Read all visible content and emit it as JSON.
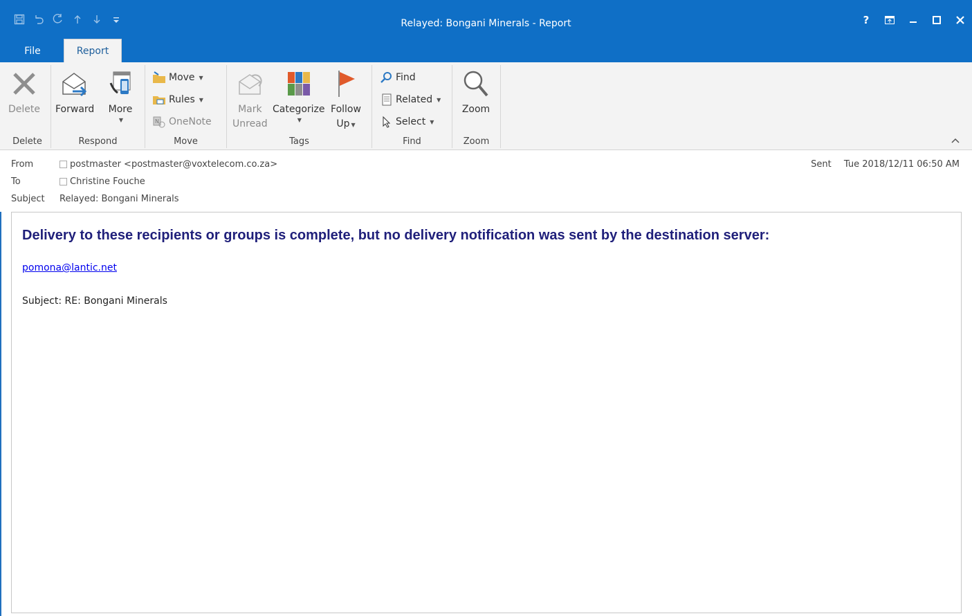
{
  "window": {
    "title": "Relayed: Bongani Minerals - Report",
    "help_label": "?",
    "accent": "#0f6fc6"
  },
  "quick_access": [
    "save-icon",
    "undo-icon",
    "redo-icon",
    "up-icon",
    "down-icon",
    "customize-icon"
  ],
  "tabs": {
    "file": "File",
    "report": "Report"
  },
  "ribbon": {
    "delete": {
      "button": "Delete",
      "group": "Delete"
    },
    "respond": {
      "forward": "Forward",
      "more": "More",
      "group": "Respond"
    },
    "move": {
      "move": "Move",
      "rules": "Rules",
      "onenote": "OneNote",
      "group": "Move"
    },
    "tags": {
      "mark_l1": "Mark",
      "mark_l2": "Unread",
      "categorize": "Categorize",
      "follow_l1": "Follow",
      "follow_l2": "Up",
      "group": "Tags"
    },
    "find": {
      "find": "Find",
      "related": "Related",
      "select": "Select",
      "group": "Find"
    },
    "zoom": {
      "button": "Zoom",
      "group": "Zoom"
    }
  },
  "header": {
    "from_label": "From",
    "from_value": "postmaster <postmaster@voxtelecom.co.za>",
    "to_label": "To",
    "to_value": "Christine Fouche",
    "subject_label": "Subject",
    "subject_value": "Relayed: Bongani Minerals",
    "sent_label": "Sent",
    "sent_value": "Tue 2018/12/11 06:50 AM"
  },
  "message": {
    "headline": "Delivery to these recipients or groups is complete, but no delivery notification was sent by the destination server:",
    "recipient": "pomona@lantic.net",
    "subject_line": "Subject: RE: Bongani Minerals"
  }
}
